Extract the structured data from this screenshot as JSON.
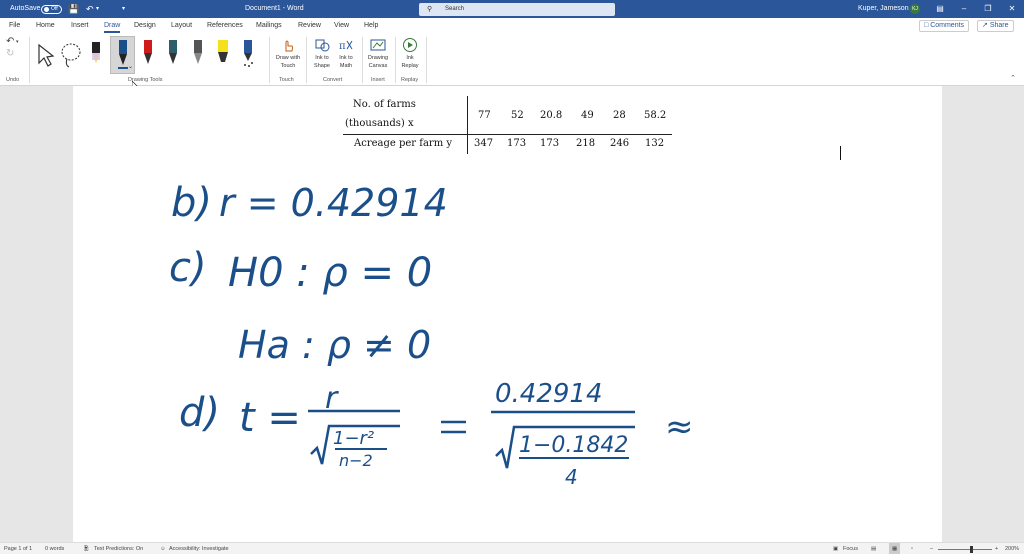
{
  "titlebar": {
    "autosave_label": "AutoSave",
    "autosave_state": "Off",
    "document_title": "Document1  -  Word",
    "search_placeholder": "Search",
    "user_name": "Kuper, Jameson",
    "user_initials": "KJ"
  },
  "tabs": [
    {
      "label": "File"
    },
    {
      "label": "Home"
    },
    {
      "label": "Insert"
    },
    {
      "label": "Draw"
    },
    {
      "label": "Design"
    },
    {
      "label": "Layout"
    },
    {
      "label": "References"
    },
    {
      "label": "Mailings"
    },
    {
      "label": "Review"
    },
    {
      "label": "View"
    },
    {
      "label": "Help"
    }
  ],
  "actions": {
    "comments": "Comments",
    "share": "Share"
  },
  "ribbon": {
    "groups": {
      "undo": "Undo",
      "drawing_tools": "Drawing Tools",
      "touch": "Touch",
      "convert": "Convert",
      "insert": "Insert",
      "replay": "Replay"
    },
    "buttons": {
      "draw_with_touch": "Draw with Touch",
      "ink_to_shape": "Ink to Shape",
      "ink_to_math": "Ink to Math",
      "drawing_canvas": "Drawing Canvas",
      "ink_replay": "Ink Replay"
    }
  },
  "document": {
    "table": {
      "row1_label_line1": "No. of farms",
      "row1_label_line2": "(thousands) x",
      "row2_label": "Acreage per farm y",
      "x_values": [
        "77",
        "52",
        "20.8",
        "49",
        "28",
        "58.2"
      ],
      "y_values": [
        "347",
        "173",
        "173",
        "218",
        "246",
        "132"
      ]
    },
    "ink": {
      "b_label": "b)",
      "b_content": "r = 0.42914",
      "c_label": "c)",
      "c_h0": "H0 : ρ = 0",
      "c_ha": "Ha : ρ ≠ 0",
      "d_label": "d)",
      "d_lhs": "t =",
      "d_num1": "r",
      "d_den1_top": "1−r²",
      "d_den1_bottom": "n−2",
      "d_num2": "0.42914",
      "d_den2_top": "1−0.1842",
      "d_den2_bottom": "4",
      "approx": "≈"
    }
  },
  "statusbar": {
    "page": "Page 1 of 1",
    "words": "0 words",
    "text_predictions": "Text Predictions: On",
    "accessibility": "Accessibility: Investigate",
    "focus": "Focus",
    "zoom": "200%"
  },
  "colors": {
    "accent": "#2b579a",
    "ink": "#1b4f8a"
  }
}
